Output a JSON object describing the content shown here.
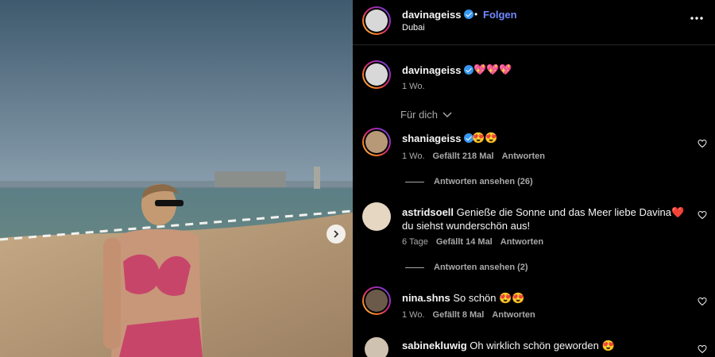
{
  "post": {
    "username": "davinageiss",
    "separator": "•",
    "follow_label": "Folgen",
    "location": "Dubai",
    "more_icon": "more-horizontal-icon",
    "caption_emoji": "💖💖💖",
    "caption_time": "1 Wo."
  },
  "sort": {
    "label": "Für dich",
    "icon": "chevron-down-icon"
  },
  "comments": [
    {
      "username": "shaniageiss",
      "verified": true,
      "text": "😍😍",
      "time": "1 Wo.",
      "likes": "Gefällt 218 Mal",
      "reply": "Antworten",
      "view_replies": "Antworten ansehen (26)"
    },
    {
      "username": "astridsoell",
      "verified": false,
      "text_line1": "Genieße die Sonne und das Meer liebe Davina❤️",
      "text_line2": "du siehst wunderschön aus!",
      "time": "6 Tage",
      "likes": "Gefällt 14 Mal",
      "reply": "Antworten",
      "view_replies": "Antworten ansehen (2)"
    },
    {
      "username": "nina.shns",
      "verified": false,
      "text": "So schön 😍😍",
      "time": "1 Wo.",
      "likes": "Gefällt 8 Mal",
      "reply": "Antworten"
    },
    {
      "username": "sabinekluwig",
      "verified": false,
      "text": "Oh wirklich schön geworden 😍"
    }
  ],
  "colors": {
    "accent": "#3897f0",
    "follow": "#7089ff",
    "background": "#000000",
    "muted": "#a8a8a8"
  }
}
